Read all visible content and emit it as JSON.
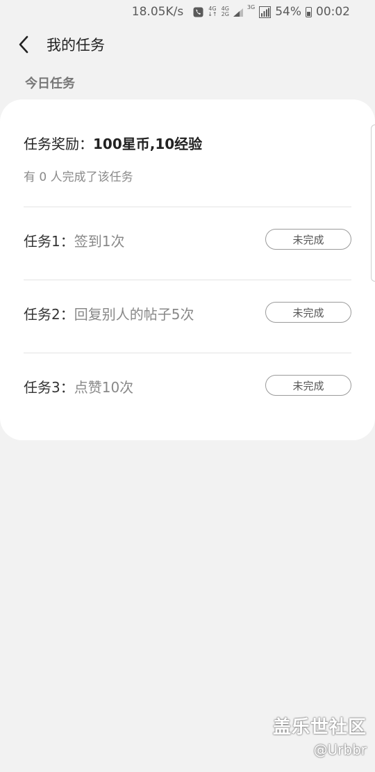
{
  "status_bar": {
    "net_speed": "18.05K/s",
    "net_4g_top": "4G",
    "net_4g_bottom": "↓↑",
    "net_4g2g_top": "4G",
    "net_4g2g_bottom": "2G",
    "net_3g": "3G",
    "battery_percent": "54%",
    "time": "00:02"
  },
  "header": {
    "title": "我的任务"
  },
  "section": {
    "label": "今日任务"
  },
  "reward": {
    "prefix": "任务奖励：",
    "value": "100星币,10经验"
  },
  "completed_text": "有 0 人完成了该任务",
  "tasks": [
    {
      "label": "任务1：",
      "desc": "签到1次",
      "status": "未完成"
    },
    {
      "label": "任务2：",
      "desc": "回复别人的帖子5次",
      "status": "未完成"
    },
    {
      "label": "任务3：",
      "desc": "点赞10次",
      "status": "未完成"
    }
  ],
  "watermark": {
    "main": "盖乐世社区",
    "sub": "@Urbbr"
  },
  "icons": {
    "back": "back-arrow-icon",
    "phone": "phone-icon",
    "signal": "signal-icon",
    "battery": "battery-icon"
  }
}
